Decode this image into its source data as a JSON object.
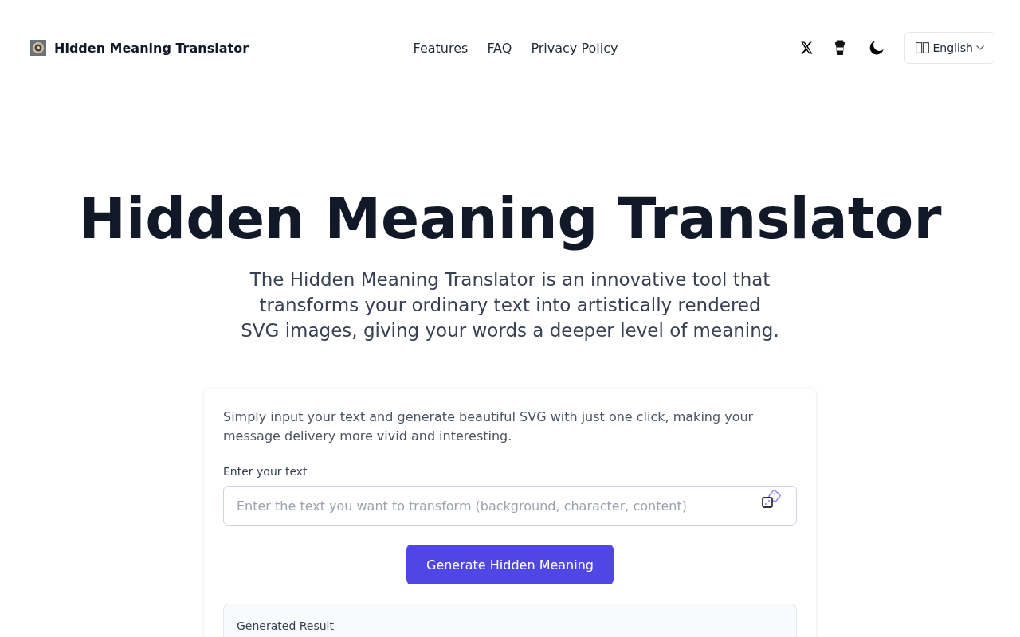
{
  "header": {
    "site_title": "Hidden Meaning Translator",
    "nav_links": [
      "Features",
      "FAQ",
      "Privacy Policy"
    ],
    "language": {
      "label": "English"
    }
  },
  "hero": {
    "title": "Hidden Meaning Translator",
    "description": "The Hidden Meaning Translator is an innovative tool that transforms your ordinary text into artistically rendered SVG images, giving your words a deeper level of meaning."
  },
  "translator_card": {
    "intro": "Simply input your text and generate beautiful SVG with just one click, making your message delivery more vivid and interesting.",
    "input": {
      "label": "Enter your text",
      "placeholder": "Enter the text you want to transform (background, character, content)"
    },
    "generate_button": "Generate Hidden Meaning",
    "result": {
      "title": "Generated Result"
    }
  }
}
